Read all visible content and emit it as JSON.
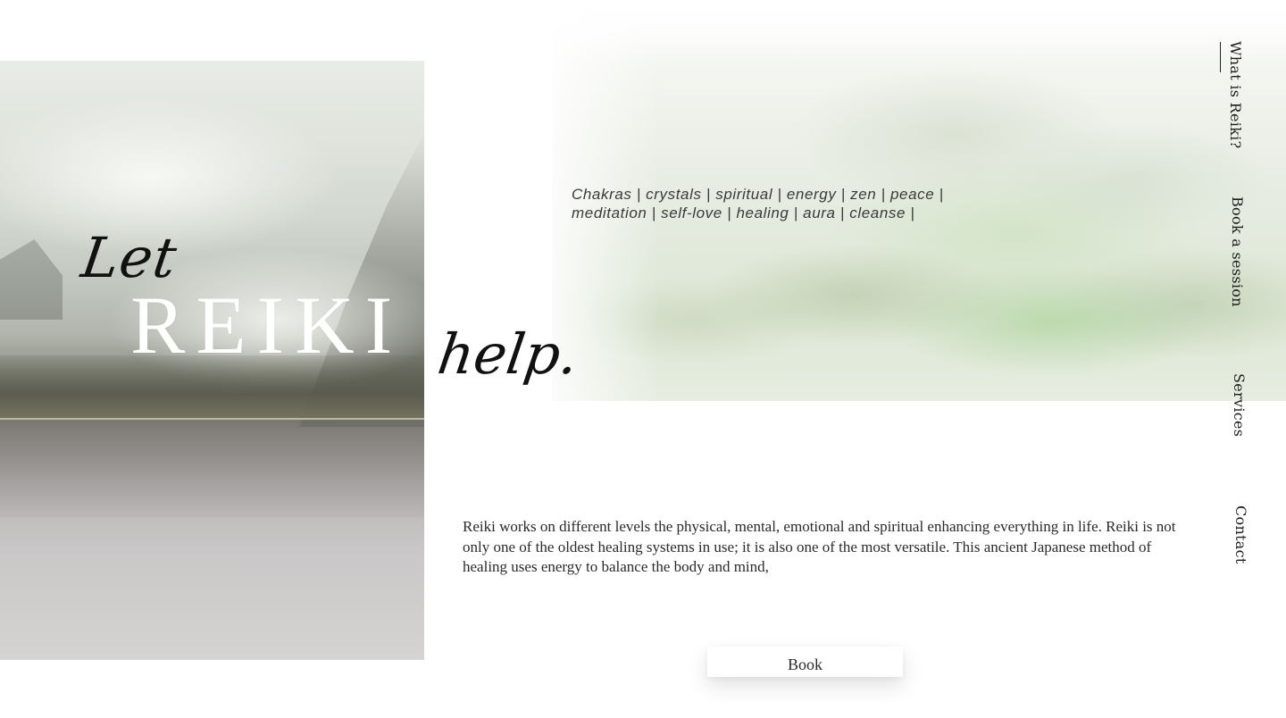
{
  "hero": {
    "let": "Let",
    "reiki": "REIKI",
    "help": "help."
  },
  "tags": {
    "line1": "Chakras  | crystals | spiritual | energy | zen | peace  |",
    "line2": "meditation | self-love | healing | aura |  cleanse  |"
  },
  "nav": {
    "items": [
      {
        "label": "What is Reiki?",
        "active": true
      },
      {
        "label": "Book a session",
        "active": false
      },
      {
        "label": "Services",
        "active": false
      },
      {
        "label": "Contact",
        "active": false
      }
    ]
  },
  "body": {
    "paragraph": "Reiki works on different levels the physical, mental, emotional and spiritual enhancing everything in life. Reiki is not only one of the oldest healing systems in use; it is also one of the most versatile. This ancient Japanese method of healing uses energy to balance the body and mind,"
  },
  "book_button": {
    "label": "Book"
  },
  "colors": {
    "text": "#1d1d1d",
    "hero_script": "#111111",
    "hero_title": "#ffffff",
    "watercolor_green": "#a0cd8c",
    "background": "#ffffff"
  }
}
